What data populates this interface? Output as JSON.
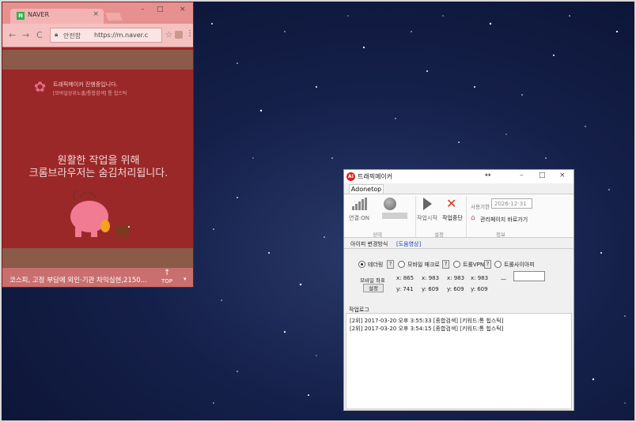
{
  "colors": {
    "desktop": "#15204a",
    "browser_overlay": "#9b2828",
    "app_accent": "#d42323",
    "link_blue": "#1a3fc4"
  },
  "browser": {
    "tab_title": "NAVER",
    "favicon": "N",
    "tab_close": "×",
    "window_buttons": {
      "minimize": "–",
      "maximize": "□",
      "close": "×"
    },
    "nav": {
      "back": "←",
      "forward": "→",
      "reload": "C"
    },
    "omnibox": {
      "secure_label": "안전함",
      "url": "https://m.naver.c"
    },
    "notice": {
      "title": "트래픽메이커 진행중입니다.",
      "subtitle": "[모바일상위노출/통합검색] 통 힙스틱"
    },
    "message": {
      "line1": "원활한 작업을 위해",
      "line2": "크롬브라우저는 숨김처리됩니다."
    },
    "ticker": {
      "text": "코스피, 고정 부담에 외인·기관 차익실현,2150...",
      "top_label": "TOP",
      "up_icon": "↑",
      "dropdown_icon": "▾"
    }
  },
  "app": {
    "logo_text": "AI",
    "title": "트래픽메이커",
    "move_icon": "↔",
    "window_buttons": {
      "minimize": "–",
      "maximize": "□",
      "close": "×"
    },
    "tab": "Adonetop",
    "status": {
      "connection": "연결:ON",
      "group_label": "상태"
    },
    "actions": {
      "start": "작업시작",
      "stop": "작업중단",
      "group_label": "설정"
    },
    "info": {
      "expiry_label": "사용기한",
      "expiry_value": "2026-12-31",
      "admin_link": "관리페이지 바로가기",
      "group_label": "정보"
    },
    "sub_tabs": {
      "ip_change": "아이피 변경방식",
      "help_video": "[도움영상]"
    },
    "ip_methods": [
      {
        "label": "테더링",
        "selected": true
      },
      {
        "label": "모바일 매크로",
        "selected": false
      },
      {
        "label": "트롤VPN",
        "selected": false
      },
      {
        "label": "트롤사이아피",
        "selected": false
      }
    ],
    "help_mark": "?",
    "mobile_coords": {
      "label": "모바일 좌표",
      "set_button": "설정",
      "x": [
        "x: 865",
        "x: 983",
        "x: 983",
        "x: 983"
      ],
      "y": [
        "y: 741",
        "y: 609",
        "y: 609",
        "y: 609"
      ],
      "dash": "—"
    },
    "log": {
      "label": "작업로그",
      "lines": [
        "[2위] 2017-03-20 오후 3:55:33  [종합검색] [키워드:통 힙스틱]",
        "[2위] 2017-03-20 오후 3:54:15  [종합검색] [키워드:통 힙스틱]"
      ]
    }
  }
}
